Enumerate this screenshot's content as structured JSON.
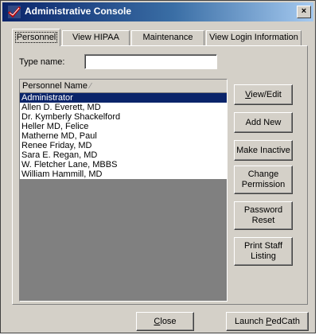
{
  "window": {
    "title": "Administrative Console",
    "close_glyph": "×"
  },
  "tabs": [
    {
      "label": "Personnel"
    },
    {
      "label": "View HIPAA"
    },
    {
      "label": "Maintenance"
    },
    {
      "label": "View Login Information"
    }
  ],
  "type_name": {
    "label": "Type name:",
    "value": ""
  },
  "list": {
    "header": "Personnel Name",
    "sort_glyph": "⁄",
    "rows": [
      "Administrator",
      "Allen D. Everett, MD",
      "Dr. Kymberly Shackelford",
      "Heller MD, Felice",
      "Matherne MD, Paul",
      "Renee Friday, MD",
      "Sara E. Regan, MD",
      "W. Fletcher Lane, MBBS",
      "William Hammill, MD"
    ],
    "selected_index": 0
  },
  "buttons": {
    "view_edit": {
      "access": "V",
      "rest": "iew/Edit"
    },
    "add_new": "Add New",
    "make_inactive": "Make Inactive",
    "change_permission": {
      "l1": "Change",
      "l2": "Permission"
    },
    "password_reset": {
      "l1": "Password",
      "l2": "Reset"
    },
    "print_staff": {
      "l1": "Print Staff",
      "l2": "Listing"
    },
    "close": {
      "access": "C",
      "rest": "lose"
    },
    "launch": {
      "pre": "Launch ",
      "access": "P",
      "rest": "edCath"
    }
  },
  "colors": {
    "selection": "#0a246a",
    "title_start": "#0a246a",
    "title_end": "#a6caf0",
    "face": "#d4d0c8"
  },
  "icons": {
    "title": "checkmark-app-icon"
  }
}
